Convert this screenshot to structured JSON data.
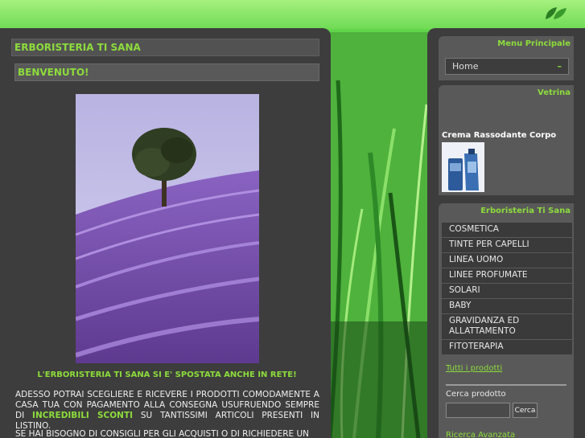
{
  "site": {
    "title": "ERBORISTERIA TI SANA",
    "welcome": "BENVENUTO!",
    "announcement": "L'ERBORISTERIA TI SANA SI E' SPOSTATA ANCHE IN RETE!",
    "body_part1": "ADESSO POTRAI SCEGLIERE E RICEVERE I PRODOTTI COMODAMENTE A CASA TUA CON PAGAMENTO ALLA CONSEGNA USUFRUENDO SEMPRE DI ",
    "body_highlight": "INCREDIBILI SCONTI",
    "body_part2": " SU TANTISSIMI ARTICOLI PRESENTI IN LISTINO.",
    "body_second": "SE HAI BISOGNO DI CONSIGLI PER GLI ACQUISTI O DI RICHIEDERE UN",
    "accent_color": "#8ddc3c"
  },
  "sidebar": {
    "menu_title": "Menu Principale",
    "home_label": "Home",
    "home_toggle": "–",
    "vetrina_title": "Vetrina",
    "product_name": "Crema Rassodante Corpo",
    "categories_title": "Erboristeria Ti Sana",
    "categories": [
      "COSMETICA",
      "TINTE PER CAPELLI",
      "LINEA UOMO",
      "LINEE PROFUMATE",
      "SOLARI",
      "BABY",
      "GRAVIDANZA ED ALLATTAMENTO",
      "FITOTERAPIA"
    ],
    "all_products": "Tutti i prodotti",
    "search_label": "Cerca prodotto",
    "search_value": "",
    "search_button": "Cerca",
    "advanced_search": "Ricerca Avanzata"
  },
  "icons": {
    "logo": "leaf-icon"
  }
}
